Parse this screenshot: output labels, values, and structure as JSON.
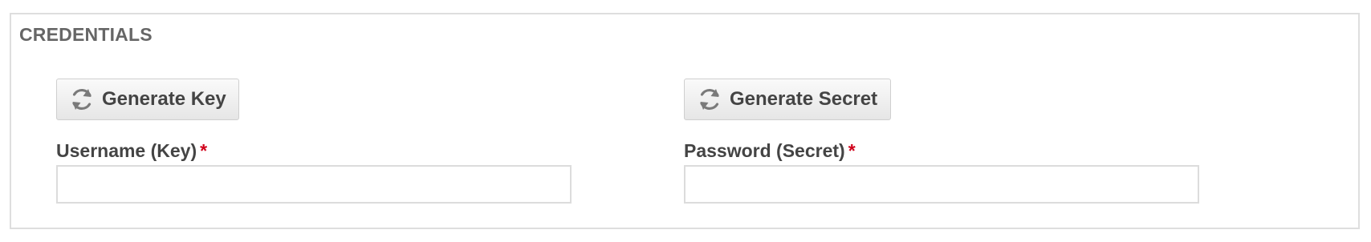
{
  "section": {
    "title": "CREDENTIALS"
  },
  "buttons": {
    "generate_key": {
      "label": "Generate Key",
      "icon": "refresh-icon"
    },
    "generate_secret": {
      "label": "Generate Secret",
      "icon": "refresh-icon"
    }
  },
  "fields": {
    "username": {
      "label": "Username (Key)",
      "required_marker": "*",
      "value": "",
      "placeholder": ""
    },
    "password": {
      "label": "Password (Secret)",
      "required_marker": "*",
      "value": "",
      "placeholder": ""
    }
  },
  "colors": {
    "required": "#d0021b",
    "border": "#dedede",
    "text": "#444444",
    "title": "#666666"
  }
}
